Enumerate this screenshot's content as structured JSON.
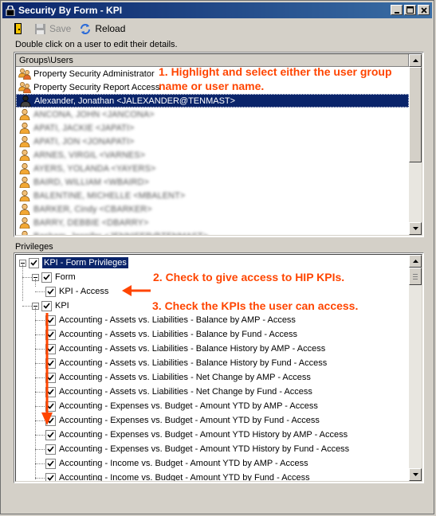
{
  "window": {
    "title": "Security By Form - KPI"
  },
  "toolbar": {
    "save_label": "Save",
    "reload_label": "Reload"
  },
  "hint_text": "Double click on a user to edit their details.",
  "groups_pane": {
    "header": "Groups\\Users",
    "rows": [
      {
        "label": "Property Security Administrator",
        "type": "group",
        "selected": false,
        "blurred": false
      },
      {
        "label": "Property Security Report Access",
        "type": "group",
        "selected": false,
        "blurred": false
      },
      {
        "label": "Alexander, Jonathan <JALEXANDER@TENMAST>",
        "type": "user",
        "selected": true,
        "blurred": false
      },
      {
        "label": "ANCONA, JOHN <JANCONA>",
        "type": "user",
        "selected": false,
        "blurred": true
      },
      {
        "label": "APATI, JACKIE <JAPATI>",
        "type": "user",
        "selected": false,
        "blurred": true
      },
      {
        "label": "APATI, JON <JONAPATI>",
        "type": "user",
        "selected": false,
        "blurred": true
      },
      {
        "label": "ARNES, VIRGIL <VARNES>",
        "type": "user",
        "selected": false,
        "blurred": true
      },
      {
        "label": "AYERS, YOLANDA <YAYERS>",
        "type": "user",
        "selected": false,
        "blurred": true
      },
      {
        "label": "BAIRD, WILLIAM <WBAIRD>",
        "type": "user",
        "selected": false,
        "blurred": true
      },
      {
        "label": "BALENTINE, MICHELLE <MBALENT>",
        "type": "user",
        "selected": false,
        "blurred": true
      },
      {
        "label": "BARKER, Cindy <CBARKER>",
        "type": "user",
        "selected": false,
        "blurred": true
      },
      {
        "label": "BARRY, DEBBIE <DBARRY>",
        "type": "user",
        "selected": false,
        "blurred": true
      },
      {
        "label": "Basham, Jennifer <JENNIFER@TENMAST>",
        "type": "user",
        "selected": false,
        "blurred": true
      }
    ]
  },
  "privileges_label": "Privileges",
  "tree": {
    "root": "KPI - Form Privileges",
    "form_node": "Form",
    "kpi_access": "KPI - Access",
    "kpi_node": "KPI",
    "kpi_items": [
      "Accounting - Assets vs. Liabilities - Balance by AMP - Access",
      "Accounting - Assets vs. Liabilities - Balance by Fund - Access",
      "Accounting - Assets vs. Liabilities - Balance History by AMP - Access",
      "Accounting - Assets vs. Liabilities - Balance History by Fund - Access",
      "Accounting - Assets vs. Liabilities - Net Change by AMP - Access",
      "Accounting - Assets vs. Liabilities - Net Change by Fund - Access",
      "Accounting - Expenses vs. Budget - Amount YTD by AMP - Access",
      "Accounting - Expenses vs. Budget - Amount YTD by Fund - Access",
      "Accounting - Expenses vs. Budget - Amount YTD History by AMP - Access",
      "Accounting - Expenses vs. Budget - Amount YTD History by Fund - Access",
      "Accounting - Income vs. Budget - Amount YTD by AMP - Access",
      "Accounting - Income vs. Budget - Amount YTD by Fund - Access"
    ]
  },
  "annotations": {
    "step1_line1": "1. Highlight and select either the user group",
    "step1_line2": "name or user name.",
    "step2": "2. Check to give access to HIP KPIs.",
    "step3": "3. Check the KPIs the user can access."
  },
  "colors": {
    "annotation": "#ff4500",
    "selection": "#0a246a",
    "titlebar_start": "#0a246a",
    "titlebar_end": "#3a6ea5"
  }
}
